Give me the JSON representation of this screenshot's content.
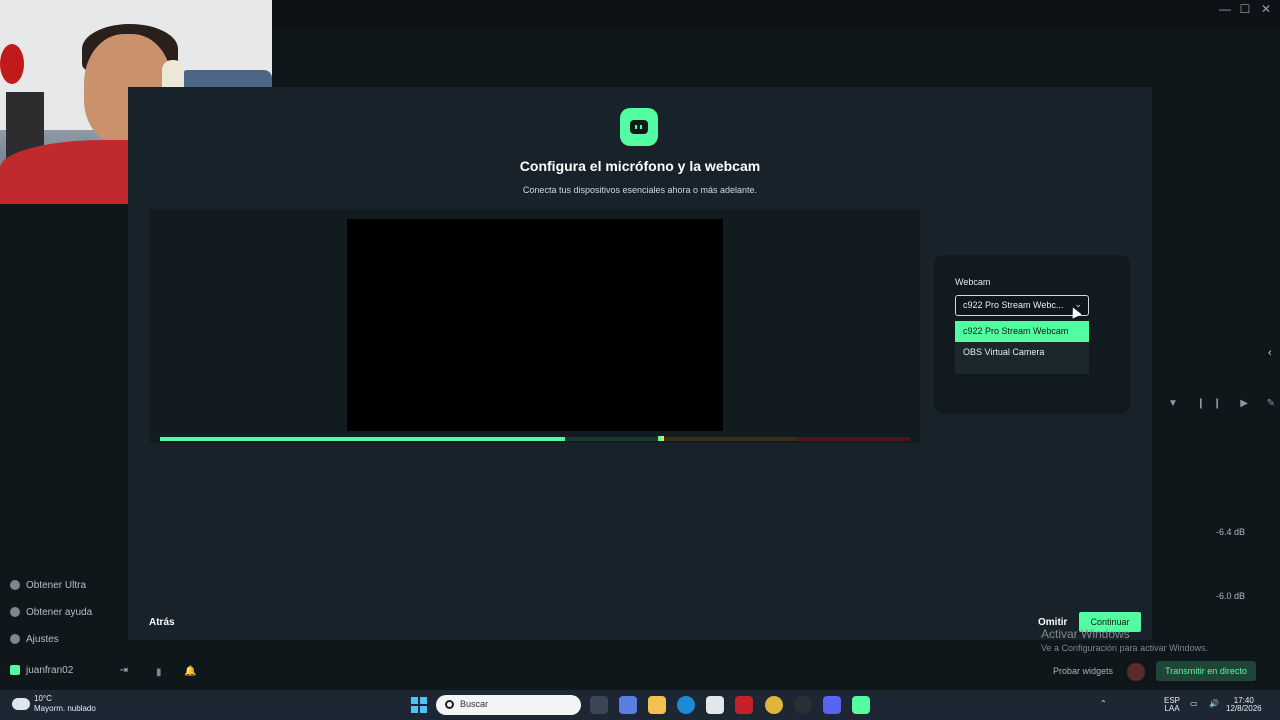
{
  "window": {
    "controls": {
      "minimize": "—",
      "maximize": "☐",
      "close": "✕"
    }
  },
  "sidebar": {
    "items": [
      {
        "label": "Obtener Ultra",
        "icon": "sparkle-icon"
      },
      {
        "label": "Obtener ayuda",
        "icon": "help-icon"
      },
      {
        "label": "Ajustes",
        "icon": "gear-icon"
      }
    ],
    "user": {
      "name": "juanfran02",
      "icon": "streamlabs-k-icon"
    }
  },
  "modal": {
    "title": "Configura el micrófono y la webcam",
    "subtitle": "Conecta tus dispositivos esenciales ahora o más adelante.",
    "webcam_label": "Webcam",
    "webcam_selected": "c922 Pro Stream Webc...",
    "options": [
      "c922 Pro Stream Webcam",
      "OBS Virtual Camera"
    ],
    "back": "Atrás",
    "skip": "Omitir",
    "continue": "Continuar",
    "accent": "#53fca1",
    "audio_level": 0.54
  },
  "mixer": {
    "db1": "-6.4 dB",
    "db2": "-6.0 dB"
  },
  "bottom": {
    "test_widgets": "Probar widgets",
    "go_live": "Transmitir en directo"
  },
  "watermark": {
    "title": "Activar Windows",
    "subtitle": "Ve a Configuración para activar Windows."
  },
  "taskbar": {
    "temp": "10°C",
    "weather": "Mayorm. nublado",
    "search": "Buscar",
    "lang1": "ESP",
    "lang2": "LAA",
    "time": "17:40",
    "date": "12/8/2026"
  }
}
